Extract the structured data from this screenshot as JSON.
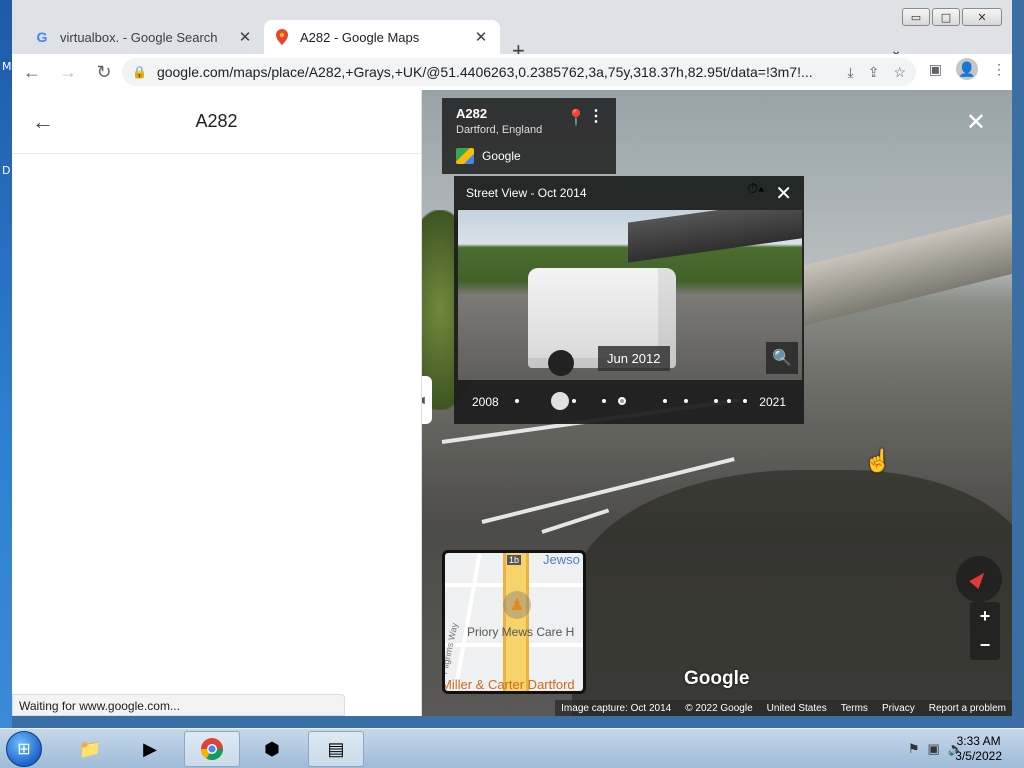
{
  "desktop": {
    "left_labels": [
      "M",
      "D"
    ]
  },
  "window": {
    "controls": {
      "minimize": "▭",
      "maximize": "□",
      "close": "✕"
    }
  },
  "tabs": [
    {
      "title": "virtualbox. - Google Search",
      "favicon": "google-g-icon",
      "close": "✕"
    },
    {
      "title": "A282 - Google Maps",
      "favicon": "maps-pin-icon",
      "close": "✕"
    }
  ],
  "tab_strip": {
    "new_tab": "+",
    "tab_search": "⌄"
  },
  "toolbar": {
    "url": "google.com/maps/place/A282,+Grays,+UK/@51.4406263,0.2385762,3a,75y,318.37h,82.95t/data=!3m7!..."
  },
  "left_panel": {
    "title": "A282"
  },
  "status_bar": {
    "text": "Waiting for www.google.com..."
  },
  "street_view": {
    "info_card": {
      "road": "A282",
      "place": "Dartford, England",
      "brand": "Google"
    },
    "time_machine": {
      "header": "Street View - Oct 2014",
      "photo_date": "Jun 2012",
      "start_year": "2008",
      "end_year": "2021"
    },
    "minimap": {
      "shield": "1b",
      "labels": [
        "Jewso",
        "Priory Mews Care H",
        "Pilgrims Way",
        "Miller & Carter Dartford"
      ]
    },
    "google_logo": "Google",
    "attribution": [
      "Image capture: Oct 2014",
      "© 2022 Google",
      "United States",
      "Terms",
      "Privacy",
      "Report a problem"
    ],
    "zoom": {
      "in": "+",
      "out": "−"
    }
  },
  "taskbar": {
    "time": "3:33 AM",
    "date": "3/5/2022",
    "apps": [
      "windows-explorer-icon",
      "media-player-icon",
      "chrome-icon",
      "virtualbox-icon",
      "control-panel-icon"
    ]
  },
  "colors": {
    "tab_active": "#ffffff",
    "tab_strip": "#dee1e6",
    "taskbar": "#b3cbe3",
    "street_view_overlay": "#1e1e1e"
  }
}
